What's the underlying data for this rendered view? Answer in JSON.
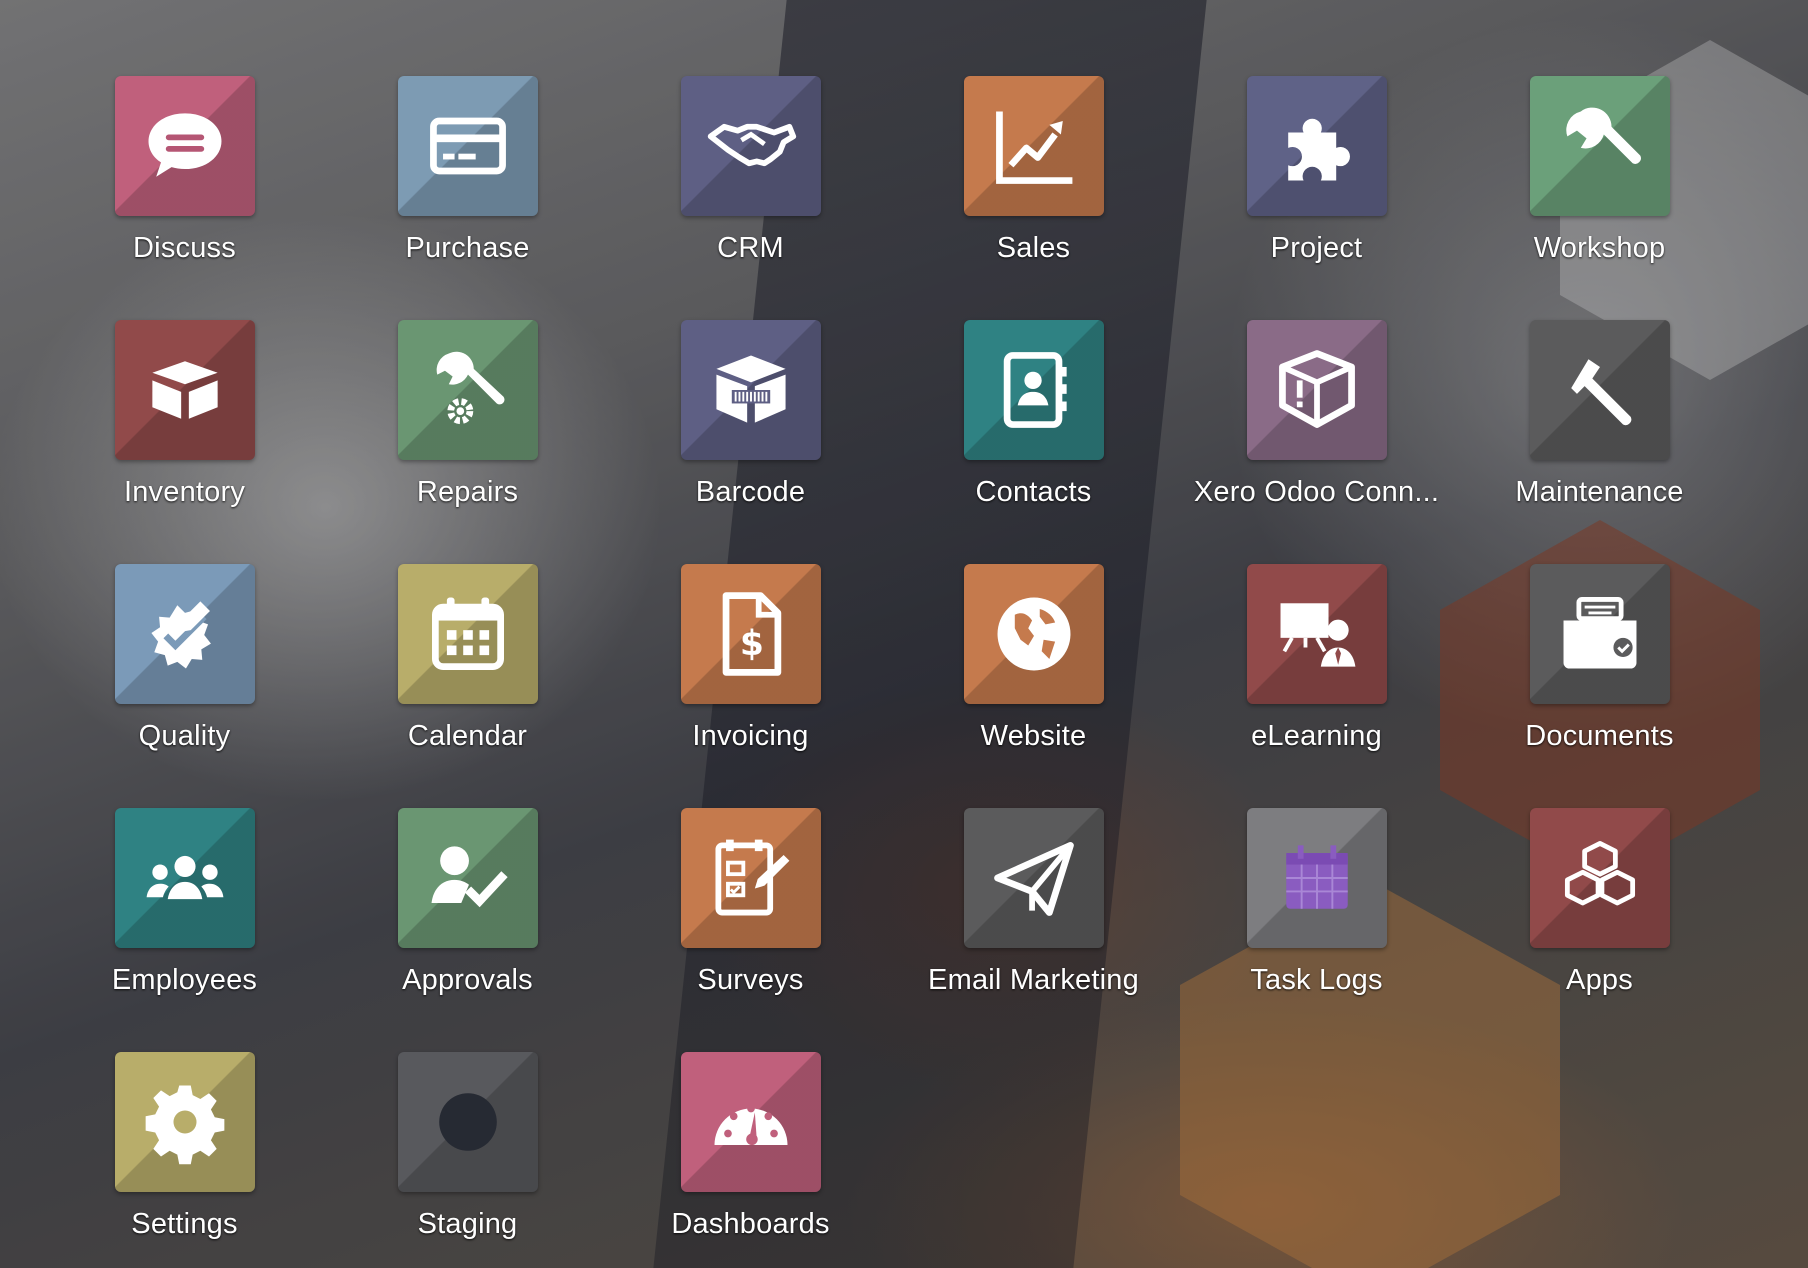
{
  "apps": [
    {
      "label": "Discuss",
      "icon": "discuss-icon",
      "color": "#c0607c"
    },
    {
      "label": "Purchase",
      "icon": "purchase-icon",
      "color": "#7d9bb3"
    },
    {
      "label": "CRM",
      "icon": "crm-icon",
      "color": "#5e5f84"
    },
    {
      "label": "Sales",
      "icon": "sales-icon",
      "color": "#c57a4d"
    },
    {
      "label": "Project",
      "icon": "project-icon",
      "color": "#5f6287"
    },
    {
      "label": "Workshop",
      "icon": "workshop-icon",
      "color": "#6ba07a"
    },
    {
      "label": "Inventory",
      "icon": "inventory-icon",
      "color": "#914a4a"
    },
    {
      "label": "Repairs",
      "icon": "repairs-icon",
      "color": "#6a9672"
    },
    {
      "label": "Barcode",
      "icon": "barcode-icon",
      "color": "#5e5f84"
    },
    {
      "label": "Contacts",
      "icon": "contacts-icon",
      "color": "#2f8283"
    },
    {
      "label": "Xero Odoo Conn...",
      "icon": "xero-connector-icon",
      "color": "#8a6b87"
    },
    {
      "label": "Maintenance",
      "icon": "maintenance-icon",
      "color": "#5b5b5c"
    },
    {
      "label": "Quality",
      "icon": "quality-icon",
      "color": "#7b9ab8"
    },
    {
      "label": "Calendar",
      "icon": "calendar-icon",
      "color": "#b8ad6a"
    },
    {
      "label": "Invoicing",
      "icon": "invoicing-icon",
      "color": "#c57a4d"
    },
    {
      "label": "Website",
      "icon": "website-icon",
      "color": "#c57a4d"
    },
    {
      "label": "eLearning",
      "icon": "elearning-icon",
      "color": "#914a4a"
    },
    {
      "label": "Documents",
      "icon": "documents-icon",
      "color": "#5b5b5c"
    },
    {
      "label": "Employees",
      "icon": "employees-icon",
      "color": "#2f8283"
    },
    {
      "label": "Approvals",
      "icon": "approvals-icon",
      "color": "#6a9672"
    },
    {
      "label": "Surveys",
      "icon": "surveys-icon",
      "color": "#c57a4d"
    },
    {
      "label": "Email Marketing",
      "icon": "email-marketing-icon",
      "color": "#5b5b5c"
    },
    {
      "label": "Task Logs",
      "icon": "task-logs-icon",
      "color": "#7d7d80"
    },
    {
      "label": "Apps",
      "icon": "apps-icon",
      "color": "#914a4a"
    },
    {
      "label": "Settings",
      "icon": "settings-icon",
      "color": "#b8ad6a"
    },
    {
      "label": "Staging",
      "icon": "staging-icon",
      "color": "#58595d"
    },
    {
      "label": "Dashboards",
      "icon": "dashboards-icon",
      "color": "#c0607c"
    }
  ]
}
